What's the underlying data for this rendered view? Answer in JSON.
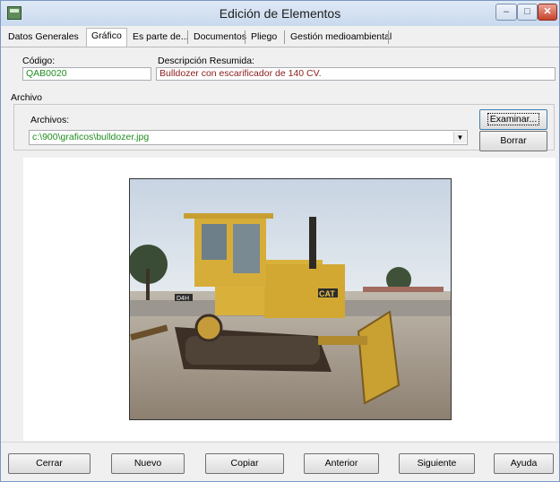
{
  "window": {
    "title": "Edición de Elementos",
    "minimize": "–",
    "maximize": "□",
    "close": "✕"
  },
  "tabs": [
    {
      "label": "Datos Generales"
    },
    {
      "label": "Gráfico"
    },
    {
      "label": "Es parte de..."
    },
    {
      "label": "Documentos"
    },
    {
      "label": "Pliego"
    },
    {
      "label": "Gestión medioambiental"
    }
  ],
  "active_tab": "Gráfico",
  "form": {
    "codigo_label": "Código:",
    "codigo_value": "QAB0020",
    "descripcion_label": "Descripción Resumida:",
    "descripcion_value": "Bulldozer con escarificador de 140 CV."
  },
  "archivo": {
    "section_label": "Archivo",
    "archivos_label": "Archivos:",
    "path_value": "c:\\900\\graficos\\bulldozer.jpg",
    "examinar_label": "Examinar...",
    "borrar_label": "Borrar"
  },
  "image": {
    "subject": "bulldozer photo",
    "badge_text": "CAT",
    "model_text": "D4H"
  },
  "footer": {
    "cerrar": "Cerrar",
    "nuevo": "Nuevo",
    "copiar": "Copiar",
    "anterior": "Anterior",
    "siguiente": "Siguiente",
    "ayuda": "Ayuda"
  },
  "colors": {
    "value_green": "#1f8c1f",
    "value_darkred": "#8b1c1c",
    "cat_yellow": "#d9b13a"
  },
  "icons": {
    "app": "app-icon",
    "dropdown": "chevron-down-icon"
  }
}
